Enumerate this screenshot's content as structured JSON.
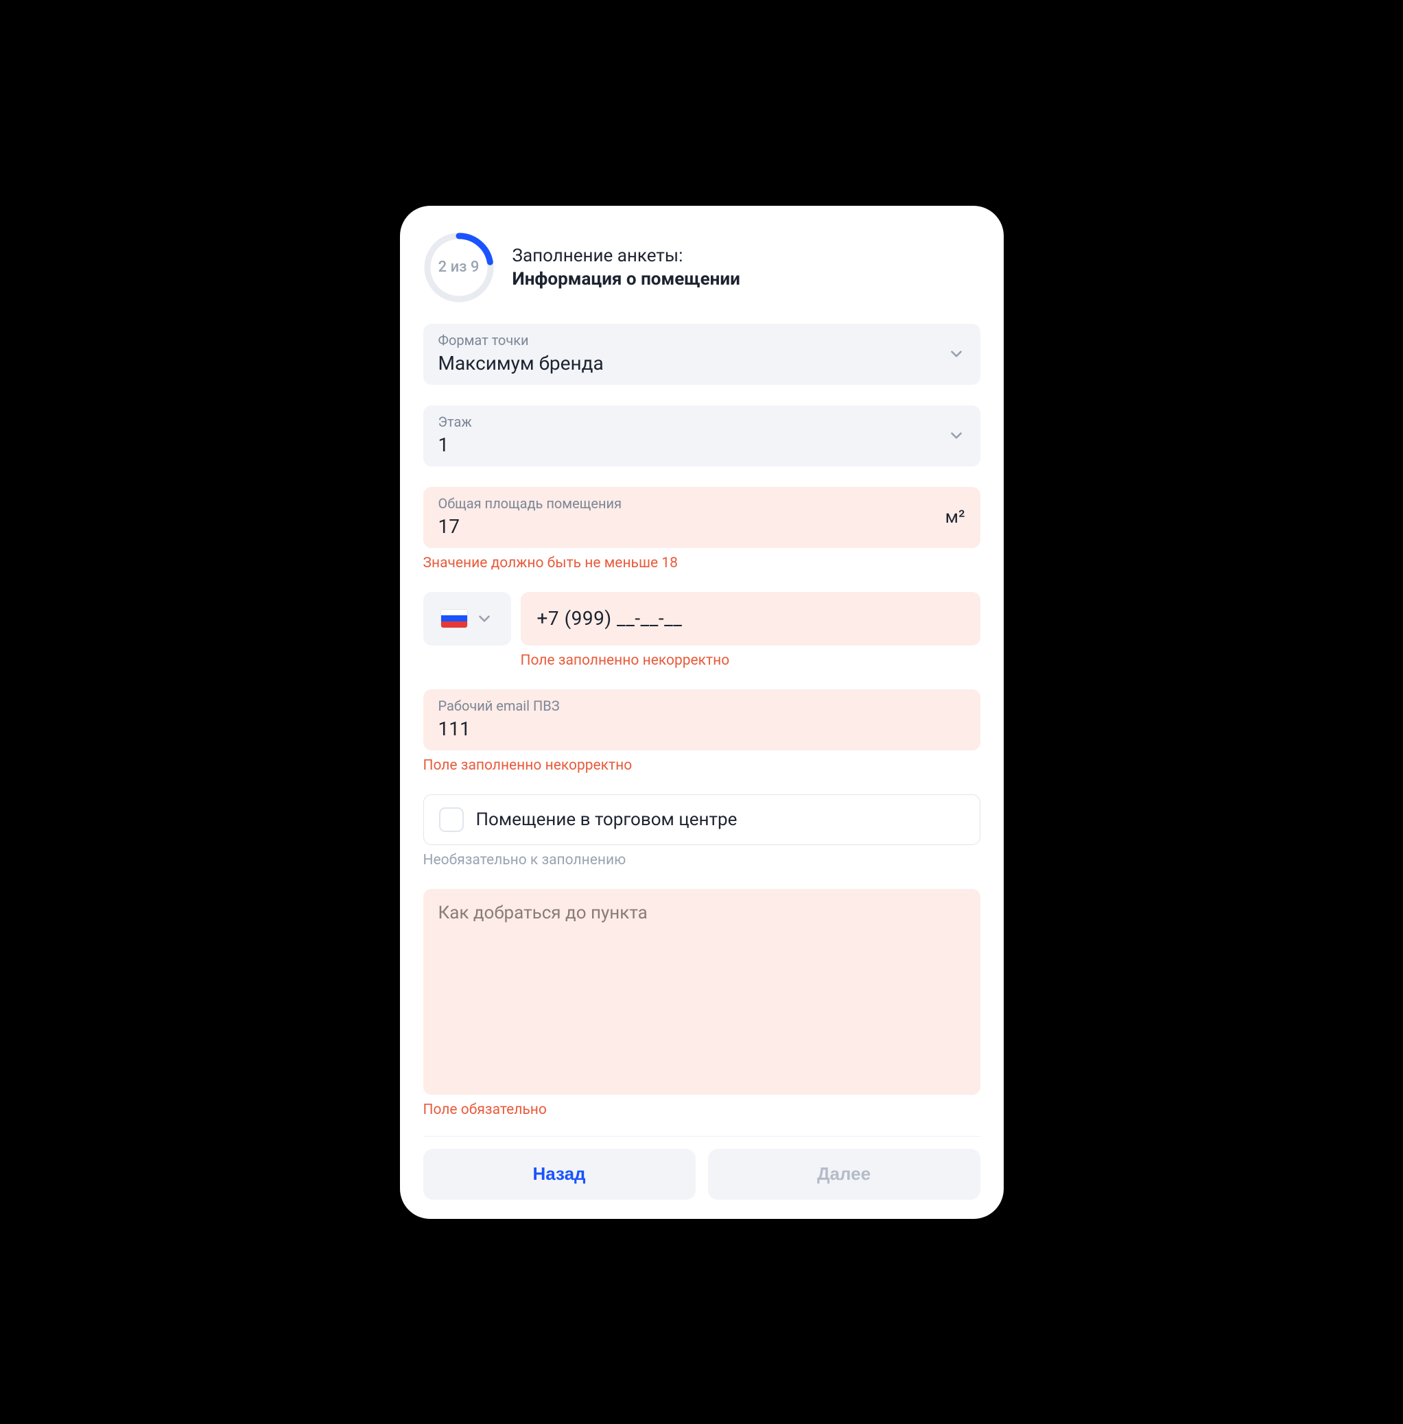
{
  "progress": {
    "current": 2,
    "total": 9,
    "label": "2 из 9",
    "frac": 0.2222
  },
  "header": {
    "line1": "Заполнение анкеты:",
    "line2": "Информация о помещении"
  },
  "format": {
    "label": "Формат точки",
    "value": "Максимум бренда"
  },
  "floor": {
    "label": "Этаж",
    "value": "1"
  },
  "area": {
    "label": "Общая площадь помещения",
    "value": "17",
    "unit": "м²",
    "error": "Значение должно быть не меньше 18"
  },
  "phone": {
    "country": "ru",
    "value": "+7 (999) __-__-__",
    "error": "Поле заполненно некорректно"
  },
  "email": {
    "label": "Рабочий email ПВЗ",
    "value": "111",
    "error": "Поле заполненно некорректно"
  },
  "mall": {
    "label": "Помещение в торговом центре",
    "checked": false,
    "hint": "Необязательно к заполнению"
  },
  "directions": {
    "placeholder": "Как добраться до пункта",
    "value": "",
    "error": "Поле обязательно"
  },
  "footer": {
    "back": "Назад",
    "next": "Далее"
  }
}
